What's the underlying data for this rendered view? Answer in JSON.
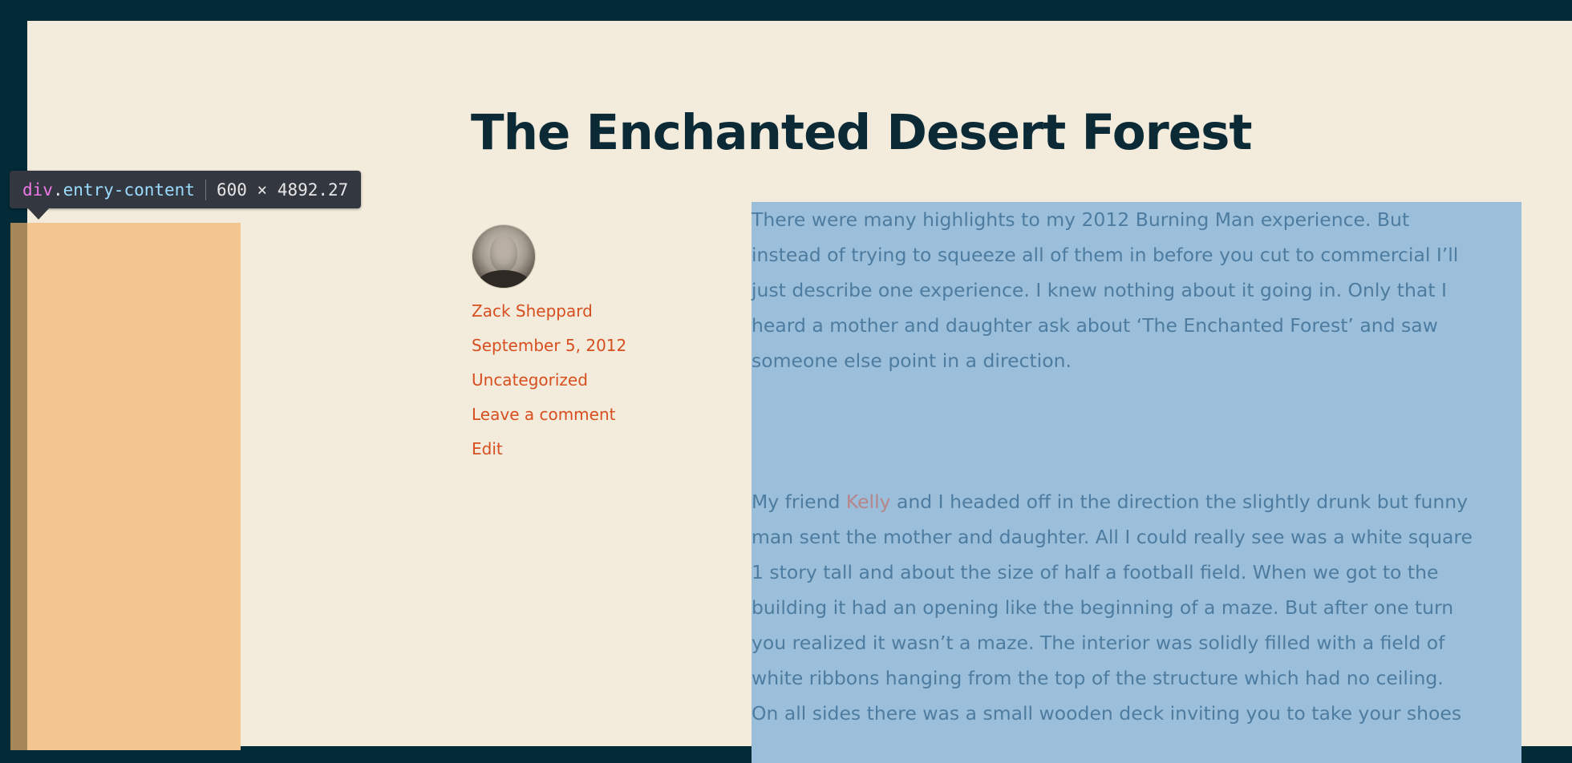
{
  "post": {
    "title": "The Enchanted Desert Forest",
    "author": "Zack Sheppard",
    "date": "September 5, 2012",
    "category": "Uncategorized",
    "comment_link": "Leave a comment",
    "edit_link": "Edit"
  },
  "content": {
    "p1_lines": [
      "There were many highlights to my 2012 Burning Man experience. But",
      "instead of trying to squeeze all of them in before you cut to commercial I’ll",
      "just describe one experience. I knew nothing about it going in. Only that I",
      "heard a mother and daughter ask about ‘The Enchanted Forest’ and saw",
      "someone else point in a direction."
    ],
    "p2_first_before": "My friend ",
    "p2_link": "Kelly",
    "p2_first_after": " and I headed off in the direction the slightly drunk but funny",
    "p2_lines": [
      "man sent the mother and daughter. All I could really see was a white square",
      "1 story tall and about the size of half a football field. When we got to the",
      "building it had an opening like the beginning of a maze. But after one turn",
      "you realized it wasn’t a maze. The interior was solidly filled with a field of",
      "white ribbons hanging from the top of the structure which had no ceiling.",
      "On all sides there was a small wooden deck inviting you to take your shoes"
    ]
  },
  "devtools": {
    "tag": "div",
    "class_name": "entry-content",
    "dimensions": "600 × 4892.27"
  },
  "colors": {
    "background": "#022a37",
    "page": "#f3ecdc",
    "title": "#0b2a36",
    "link": "#d74e1f",
    "highlight": "#9bbfda",
    "margin_highlight": "#f4c68f"
  }
}
